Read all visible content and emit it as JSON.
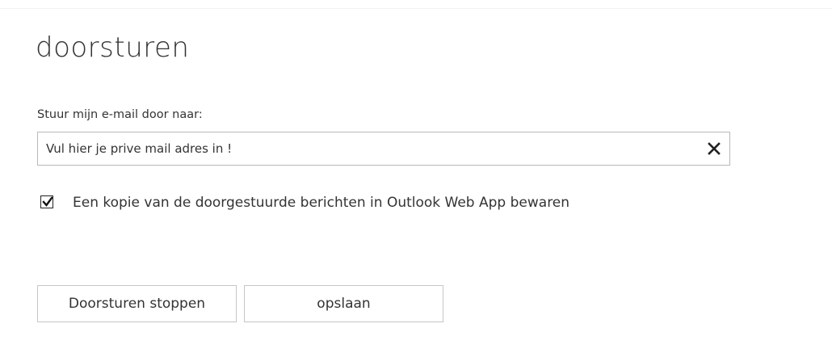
{
  "page": {
    "title": "doorsturen"
  },
  "forwarding": {
    "label": "Stuur mijn e-mail door naar:",
    "email_value": "Vul hier je prive mail adres in !",
    "clear_icon": "close-icon",
    "keep_copy_checked": true,
    "keep_copy_label": "Een kopie van de doorgestuurde berichten in Outlook Web App bewaren"
  },
  "buttons": {
    "stop_label": "Doorsturen stoppen",
    "save_label": "opslaan"
  },
  "colors": {
    "text": "#333333",
    "border": "#b8b8b8",
    "background": "#ffffff"
  }
}
